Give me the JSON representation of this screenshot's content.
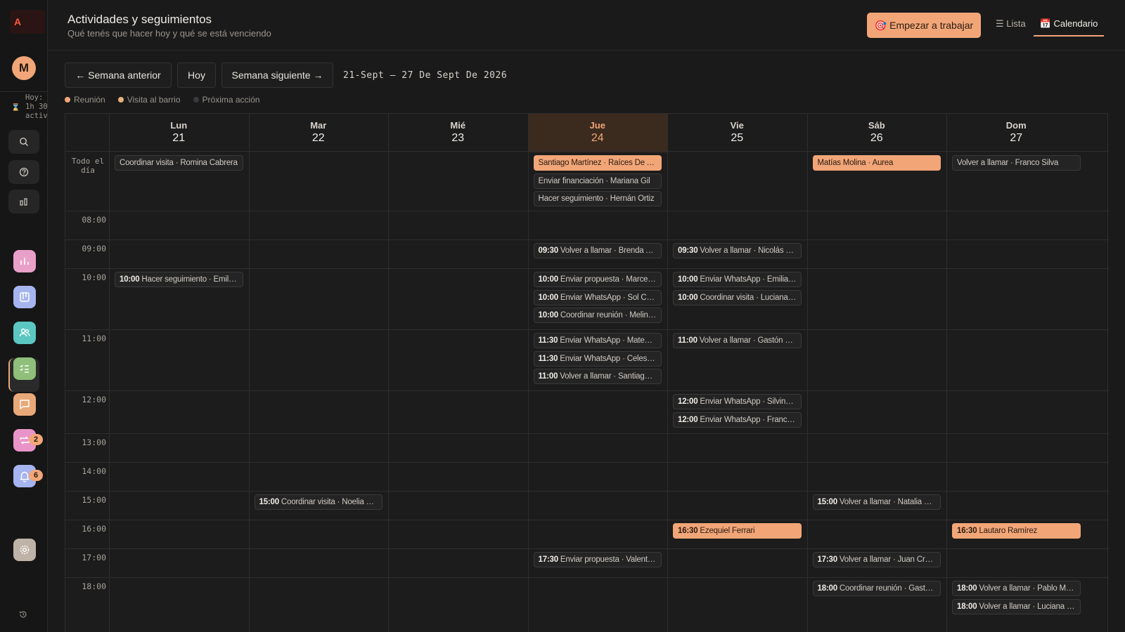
{
  "sidebar": {
    "logo": "A",
    "avatar_initial": "M",
    "timer_lines": [
      "Hoy:",
      "1h 30",
      "activ"
    ],
    "badges": {
      "sync": "2",
      "notifications": "6"
    }
  },
  "header": {
    "title": "Actividades y seguimientos",
    "subtitle": "Qué tenés que hacer hoy y qué se está venciendo",
    "start_button": "🎯 Empezar a trabajar",
    "view_list": "☰ Lista",
    "view_calendar": "📅 Calendario"
  },
  "toolbar": {
    "prev_week": "← Semana anterior",
    "today": "Hoy",
    "next_week": "Semana siguiente →",
    "range": "21-Sept – 27 De Sept De 2026"
  },
  "legend": [
    {
      "label": "Reunión",
      "color": "#f2a678"
    },
    {
      "label": "Visita al barrio",
      "color": "#e8b07a"
    },
    {
      "label": "Próxima acción",
      "color": "#3a3a3a"
    }
  ],
  "colors": {
    "accent": "#f2a678",
    "today_bg": "#3b2a1e"
  },
  "calendar": {
    "allday_label": "Todo el día",
    "days": [
      {
        "name": "Lun",
        "date": "21"
      },
      {
        "name": "Mar",
        "date": "22"
      },
      {
        "name": "Mié",
        "date": "23"
      },
      {
        "name": "Jue",
        "date": "24",
        "today": true
      },
      {
        "name": "Vie",
        "date": "25"
      },
      {
        "name": "Sáb",
        "date": "26"
      },
      {
        "name": "Dom",
        "date": "27"
      }
    ],
    "hours": [
      "08:00",
      "09:00",
      "10:00",
      "11:00",
      "12:00",
      "13:00",
      "14:00",
      "15:00",
      "16:00",
      "17:00",
      "18:00"
    ],
    "allday_events": [
      {
        "day": 0,
        "text": "Coordinar visita · Romina Cabrera"
      },
      {
        "day": 3,
        "text": "Santiago Martínez · Raíces De Alvear",
        "highlight": true
      },
      {
        "day": 3,
        "text": "Enviar financiación · Mariana Gil"
      },
      {
        "day": 3,
        "text": "Hacer seguimiento · Hernán Ortiz"
      },
      {
        "day": 5,
        "text": "Matías Molina · Aurea",
        "highlight": true
      },
      {
        "day": 6,
        "text": "Volver a llamar · Franco Silva"
      }
    ],
    "events": [
      {
        "day": 3,
        "hour": "09:00",
        "time": "09:30",
        "text": "Volver a llamar · Brenda Acosta"
      },
      {
        "day": 4,
        "hour": "09:00",
        "time": "09:30",
        "text": "Volver a llamar · Nicolás Castro"
      },
      {
        "day": 0,
        "hour": "10:00",
        "time": "10:00",
        "text": "Hacer seguimiento · Emilia Romero"
      },
      {
        "day": 3,
        "hour": "10:00",
        "time": "10:00",
        "text": "Enviar propuesta · Marcelo Díaz"
      },
      {
        "day": 3,
        "hour": "10:00",
        "time": "10:00",
        "text": "Enviar WhatsApp · Sol Carrizo"
      },
      {
        "day": 3,
        "hour": "10:00",
        "time": "10:00",
        "text": "Coordinar reunión · Melina Paz"
      },
      {
        "day": 4,
        "hour": "10:00",
        "time": "10:00",
        "text": "Enviar WhatsApp · Emilia Luna"
      },
      {
        "day": 4,
        "hour": "10:00",
        "time": "10:00",
        "text": "Coordinar visita · Luciana Vera"
      },
      {
        "day": 3,
        "hour": "11:00",
        "time": "11:30",
        "text": "Enviar WhatsApp · Mateo Ruiz"
      },
      {
        "day": 3,
        "hour": "11:00",
        "time": "11:30",
        "text": "Enviar WhatsApp · Celeste Ríos"
      },
      {
        "day": 3,
        "hour": "11:00",
        "time": "11:00",
        "text": "Volver a llamar · Santiago Herrera"
      },
      {
        "day": 4,
        "hour": "11:00",
        "time": "11:00",
        "text": "Volver a llamar · Gastón Rojas"
      },
      {
        "day": 4,
        "hour": "12:00",
        "time": "12:00",
        "text": "Enviar WhatsApp · Silvina Pérez"
      },
      {
        "day": 4,
        "hour": "12:00",
        "time": "12:00",
        "text": "Enviar WhatsApp · Franco Núñez"
      },
      {
        "day": 1,
        "hour": "15:00",
        "time": "15:00",
        "text": "Coordinar visita · Noelia Rojas"
      },
      {
        "day": 5,
        "hour": "15:00",
        "time": "15:00",
        "text": "Volver a llamar · Natalia Morales"
      },
      {
        "day": 4,
        "hour": "16:00",
        "time": "16:30",
        "text": "Ezequiel Ferrari",
        "highlight": true
      },
      {
        "day": 6,
        "hour": "16:00",
        "time": "16:30",
        "text": "Lautaro Ramírez",
        "highlight": true
      },
      {
        "day": 3,
        "hour": "17:00",
        "time": "17:30",
        "text": "Enviar propuesta · Valentina Sosa"
      },
      {
        "day": 5,
        "hour": "17:00",
        "time": "17:30",
        "text": "Volver a llamar · Juan Cruz Medina"
      },
      {
        "day": 5,
        "hour": "18:00",
        "time": "18:00",
        "text": "Coordinar reunión · Gastón Vega"
      },
      {
        "day": 6,
        "hour": "18:00",
        "time": "18:00",
        "text": "Volver a llamar · Pablo Moreno"
      },
      {
        "day": 6,
        "hour": "18:00",
        "time": "18:00",
        "text": "Volver a llamar · Luciana Silva"
      }
    ]
  }
}
